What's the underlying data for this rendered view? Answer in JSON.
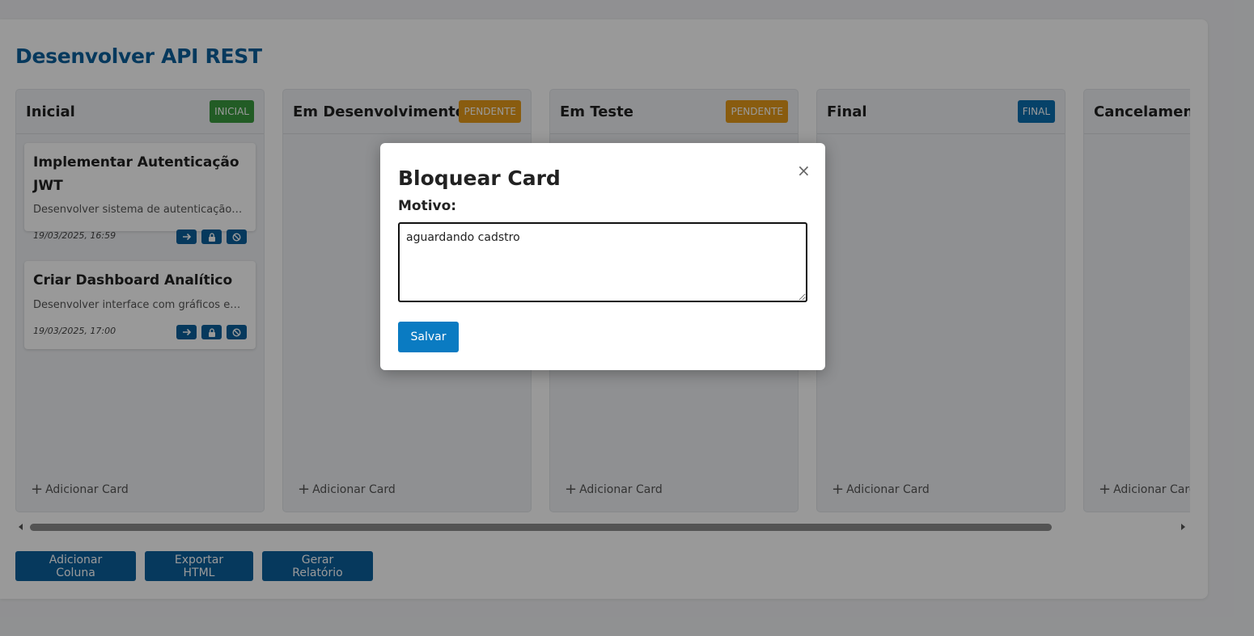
{
  "board": {
    "title": "Desenvolver API REST",
    "columns": [
      {
        "title": "Inicial",
        "badge": "INICIAL",
        "badge_color": "#3a9a3e",
        "add_label": "Adicionar Card"
      },
      {
        "title": "Em Desenvolvimento",
        "badge": "PENDENTE",
        "badge_color": "#e49a1a",
        "add_label": "Adicionar Card"
      },
      {
        "title": "Em Teste",
        "badge": "PENDENTE",
        "badge_color": "#e49a1a",
        "add_label": "Adicionar Card"
      },
      {
        "title": "Final",
        "badge": "FINAL",
        "badge_color": "#0a6fb0",
        "add_label": "Adicionar Card"
      },
      {
        "title": "Cancelamento",
        "badge": "",
        "badge_color": "",
        "add_label": "Adicionar Card"
      }
    ],
    "cards": [
      {
        "title": "Implementar Autenticação JWT",
        "description": "Desenvolver sistema de autenticação com JWT",
        "date": "19/03/2025, 16:59"
      },
      {
        "title": "Criar Dashboard Analítico",
        "description": "Desenvolver interface com gráficos e métricas",
        "date": "19/03/2025, 17:00"
      }
    ],
    "card_actions": [
      "arrow-right-icon",
      "lock-icon",
      "ban-icon"
    ]
  },
  "footer": {
    "add_column": "Adicionar Coluna",
    "export_html": "Exportar HTML",
    "report": "Gerar Relatório"
  },
  "modal": {
    "title": "Bloquear Card",
    "close": "×",
    "label": "Motivo:",
    "reason_value": "aguardando cadstro",
    "save": "Salvar"
  },
  "colors": {
    "primary": "#0a5f9c",
    "save_button": "#0a7bc2",
    "title": "#0a5f9c"
  }
}
